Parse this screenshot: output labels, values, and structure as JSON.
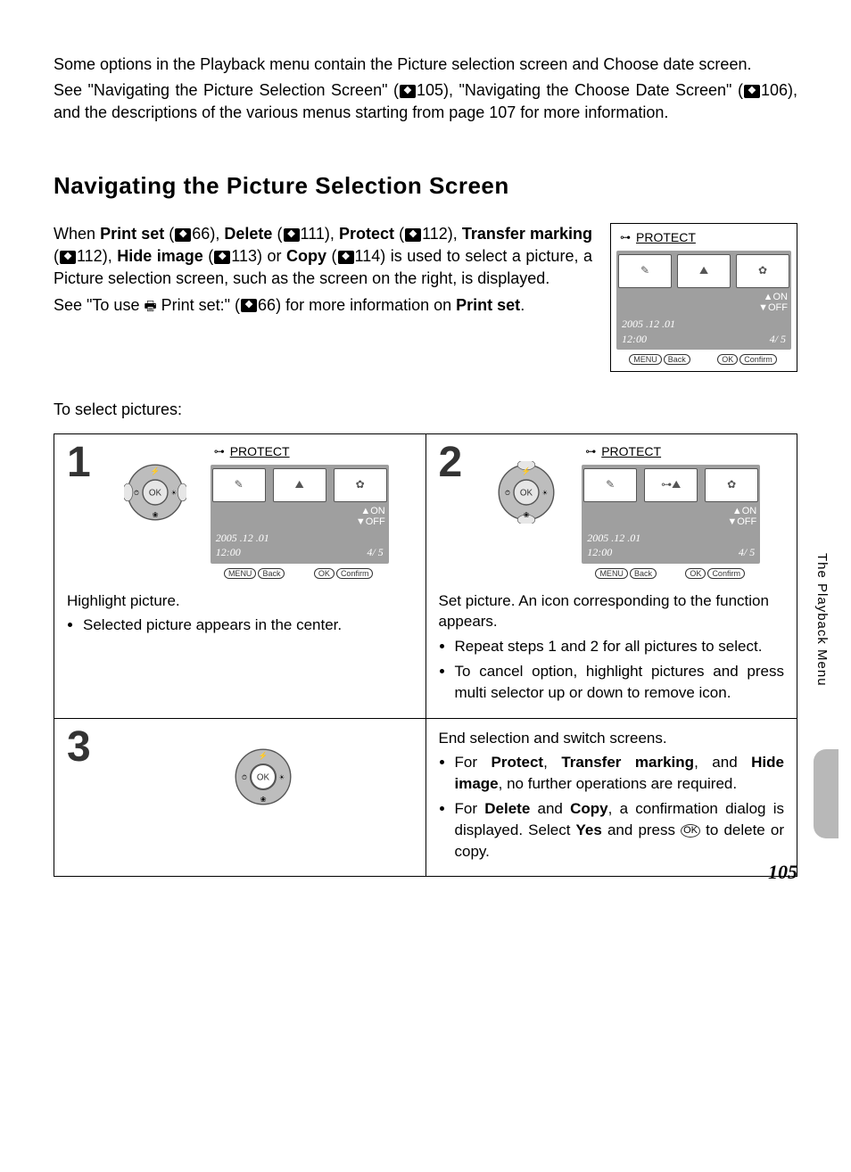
{
  "intro": {
    "p1": "Some options in the Playback menu contain the Picture selection screen and Choose date screen.",
    "p2_a": "See \"Navigating the Picture Selection Screen\" (",
    "p2_ref1": "105",
    "p2_b": "), \"Navigating the Choose Date Screen\" (",
    "p2_ref2": "106",
    "p2_c": "), and the descriptions of the various menus starting from page 107 for more information."
  },
  "heading": "Navigating the Picture Selection Screen",
  "body": {
    "p1_a": "When ",
    "p1_printset": "Print set",
    "p1_b": " (",
    "ref66": "66",
    "p1_c": "), ",
    "p1_delete": "Delete",
    "p1_d": " (",
    "ref111": "111",
    "p1_e": "), ",
    "p1_protect": "Protect",
    "p1_f": " (",
    "ref112a": "112",
    "p1_g": "), ",
    "p1_transfer": "Transfer marking",
    "p1_h": " (",
    "ref112b": "112",
    "p1_i": "), ",
    "p1_hide": "Hide image",
    "p1_j": " (",
    "ref113": "113",
    "p1_k": ") or ",
    "p1_copy": "Copy",
    "p1_l": " (",
    "ref114": "114",
    "p1_m": ") is used to select a picture, a Picture selection screen, such as the screen on the right, is displayed.",
    "p2_a": "See \"To use ",
    "p2_b": " Print set:\" (",
    "p2_c": ") for more information on ",
    "p2_printset": "Print set",
    "p2_d": "."
  },
  "screen": {
    "title": "PROTECT",
    "on": "▲ON",
    "off": "▼OFF",
    "date": "2005 .12 .01",
    "time": "12:00",
    "count": "4/   5",
    "back": "Back",
    "confirm": "Confirm",
    "menu_label": "MENU",
    "ok_label": "OK"
  },
  "to_select": "To select pictures:",
  "steps": {
    "s1_num": "1",
    "s1_text": "Highlight picture.",
    "s1_bullet": "Selected picture appears in the center.",
    "s2_num": "2",
    "s2_text": "Set picture. An icon corresponding to the function appears.",
    "s2_bullet1": "Repeat steps 1 and 2 for all pictures to select.",
    "s2_bullet2": "To cancel option, highlight pictures and press multi selector up or down to remove icon.",
    "s3_num": "3",
    "s3_text": "End selection and switch screens.",
    "s3_b1_a": "For ",
    "s3_b1_protect": "Protect",
    "s3_b1_b": ", ",
    "s3_b1_transfer": "Transfer marking",
    "s3_b1_c": ", and ",
    "s3_b1_hide": "Hide image",
    "s3_b1_d": ", no further operations are required.",
    "s3_b2_a": "For ",
    "s3_b2_delete": "Delete",
    "s3_b2_b": " and ",
    "s3_b2_copy": "Copy",
    "s3_b2_c": ", a confirmation dialog is displayed. Select ",
    "s3_b2_yes": "Yes",
    "s3_b2_d": " and press ",
    "s3_b2_e": " to delete or copy."
  },
  "side_tab": "The Playback Menu",
  "page_number": "105"
}
